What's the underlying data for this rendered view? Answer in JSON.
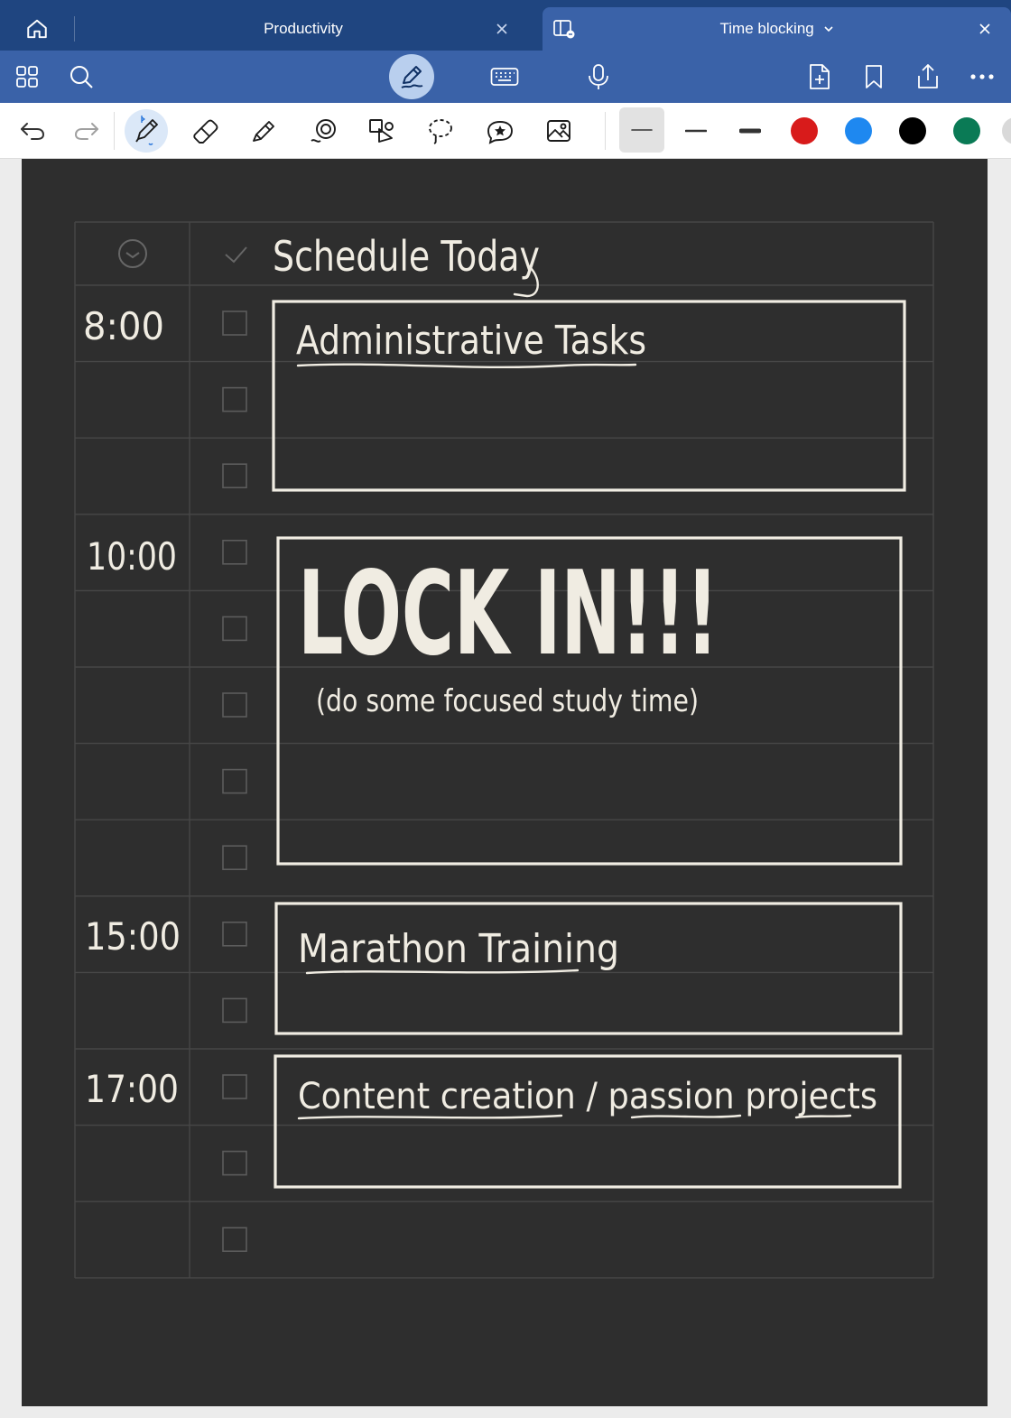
{
  "tabs": [
    {
      "label": "Productivity"
    },
    {
      "label": "Time blocking"
    }
  ],
  "icons": {
    "home": "home-icon",
    "split": "split-view-icon",
    "chevron": "chevron-down-icon",
    "close": "close-icon",
    "grid": "grid-icon",
    "search": "search-icon",
    "pen_mode": "pen-mode-icon",
    "keyboard": "keyboard-icon",
    "mic": "microphone-icon",
    "add_page": "add-page-icon",
    "bookmark": "bookmark-icon",
    "share": "share-icon",
    "more": "more-icon",
    "undo": "undo-icon",
    "redo": "redo-icon",
    "pen": "pen-icon",
    "eraser": "eraser-icon",
    "highlighter": "highlighter-icon",
    "shapes": "shapes-icon",
    "lasso": "lasso-icon",
    "sticker": "sticker-icon",
    "image": "image-icon"
  },
  "colors": {
    "tabbar": "#1f4580",
    "toolbar": "#3a62a8",
    "page": "#2e2e2e",
    "ink": "#f0ece2",
    "swatches": [
      "#d81b1b",
      "#1e88f0",
      "#000000",
      "#0a7a55"
    ]
  },
  "planner": {
    "title": "Schedule Today",
    "blocks": [
      {
        "time": "8:00",
        "heading": "Administrative Tasks"
      },
      {
        "time": "10:00",
        "heading": "LOCK IN!!!",
        "note": "(do some focused study time)"
      },
      {
        "time": "15:00",
        "heading": "Marathon Training"
      },
      {
        "time": "17:00",
        "heading": "Content creation / passion projects"
      }
    ]
  }
}
